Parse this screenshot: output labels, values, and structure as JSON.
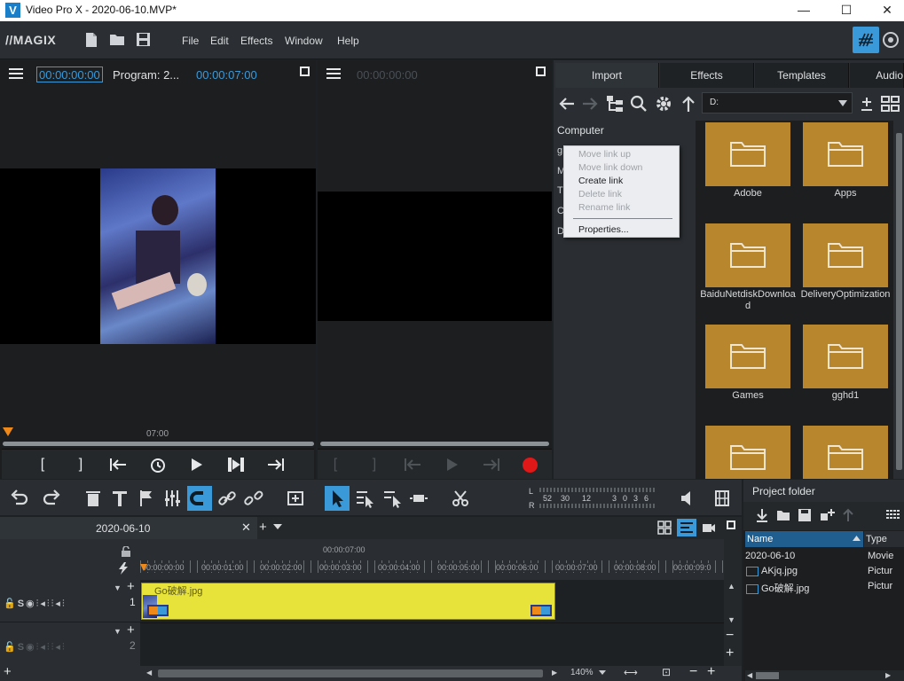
{
  "window": {
    "title": "Video Pro X - 2020-06-10.MVP*",
    "app_icon": "V",
    "controls": [
      "—",
      "☐",
      "✕"
    ]
  },
  "menubar": {
    "logo": "//MAGIX",
    "menu": [
      "File",
      "Edit",
      "Effects",
      "Window",
      "Help"
    ]
  },
  "program_monitor": {
    "timecode": "00:00:00:00",
    "label": "Program: 2...",
    "duration": "00:00:07:00",
    "scrub_label": "07:00"
  },
  "source_monitor": {
    "timecode": "00:00:00:00"
  },
  "import_panel": {
    "tabs": [
      "Import",
      "Effects",
      "Templates",
      "Audio"
    ],
    "path": "D:",
    "tree_header": "Computer",
    "tree_partial": [
      "g",
      "M",
      "T",
      "C",
      "D"
    ],
    "folders": [
      "Adobe",
      "Apps",
      "BaiduNetdiskDownload",
      "DeliveryOptimization",
      "Games",
      "gghd1",
      "",
      ""
    ]
  },
  "context_menu": {
    "items": [
      {
        "label": "Move link up",
        "enabled": false
      },
      {
        "label": "Move link down",
        "enabled": false
      },
      {
        "label": "Create link",
        "enabled": true
      },
      {
        "label": "Delete link",
        "enabled": false
      },
      {
        "label": "Rename link",
        "enabled": false
      },
      {
        "label": "Properties...",
        "enabled": true
      }
    ]
  },
  "level_meter": {
    "L": "L",
    "R": "R",
    "scale": [
      "52",
      "30",
      "12",
      "3",
      "0",
      "3",
      "6"
    ]
  },
  "timeline": {
    "tab_name": "2020-06-10",
    "playhead_time": "00:00:07:00",
    "ruler": [
      "00:00:00:00",
      "00:00:01:00",
      "00:00:02:00",
      "00:00:03:00",
      "00:00:04:00",
      "00:00:05:00",
      "00:00:06:00",
      "00:00:07:00",
      "00:00:08:00",
      "00:00:09:0"
    ],
    "tracks": [
      {
        "number": "1",
        "clip": "Go破解.jpg"
      },
      {
        "number": "2",
        "clip": ""
      }
    ],
    "zoom": "140%",
    "track_letters": "S"
  },
  "project_folder": {
    "title": "Project folder",
    "columns": [
      "Name",
      "Type"
    ],
    "rows": [
      {
        "name": "2020-06-10",
        "type": "Movie"
      },
      {
        "name": "AKjq.jpg",
        "type": "Pictur"
      },
      {
        "name": "Go破解.jpg",
        "type": "Pictur"
      }
    ]
  },
  "colors": {
    "accent_blue": "#3a9ad9",
    "folder": "#b8862d",
    "clip": "#e8e33a",
    "record": "#e01818"
  }
}
